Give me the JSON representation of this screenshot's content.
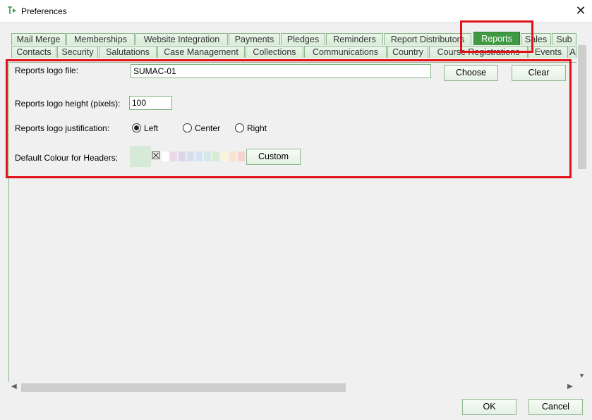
{
  "window": {
    "title": "Preferences",
    "close_glyph": "✕"
  },
  "tabs": {
    "row1": [
      {
        "label": "Mail Merge"
      },
      {
        "label": "Memberships"
      },
      {
        "label": "Website Integration"
      },
      {
        "label": "Payments"
      },
      {
        "label": "Pledges"
      },
      {
        "label": "Reminders"
      },
      {
        "label": "Report Distributors"
      },
      {
        "label": "Reports",
        "active": true
      },
      {
        "label": "Sales"
      },
      {
        "label": "Sub"
      }
    ],
    "row2": [
      {
        "label": "Contacts"
      },
      {
        "label": "Security"
      },
      {
        "label": "Salutations"
      },
      {
        "label": "Case Management"
      },
      {
        "label": "Collections"
      },
      {
        "label": "Communications"
      },
      {
        "label": "Country"
      },
      {
        "label": "Course Registrations"
      },
      {
        "label": "Events"
      },
      {
        "label": "A"
      }
    ]
  },
  "reports": {
    "logo_file_label": "Reports logo file:",
    "logo_file_value": "SUMAC-01",
    "choose_label": "Choose",
    "clear_label": "Clear",
    "logo_height_label": "Reports logo height (pixels):",
    "logo_height_value": "100",
    "justification_label": "Reports logo justification:",
    "justification_options": [
      "Left",
      "Center",
      "Right"
    ],
    "justification_selected": "Left",
    "header_colour_label": "Default Colour for Headers:",
    "header_colour": "#d7ead7",
    "palette": [
      "#ffffff",
      "#e9d7ea",
      "#ddd5ec",
      "#d4dff0",
      "#d2e3f2",
      "#d4e8ea",
      "#d6ecd6",
      "#f8f4d4",
      "#f9e3cd",
      "#f5d3d3",
      "#e9b3b3"
    ],
    "no_colour_glyph": "☒",
    "custom_label": "Custom"
  },
  "footer": {
    "ok_label": "OK",
    "cancel_label": "Cancel"
  },
  "colors": {
    "tab_active": "#3f9a43",
    "tab_border": "#8cb88c",
    "highlight": "#e2121b"
  }
}
